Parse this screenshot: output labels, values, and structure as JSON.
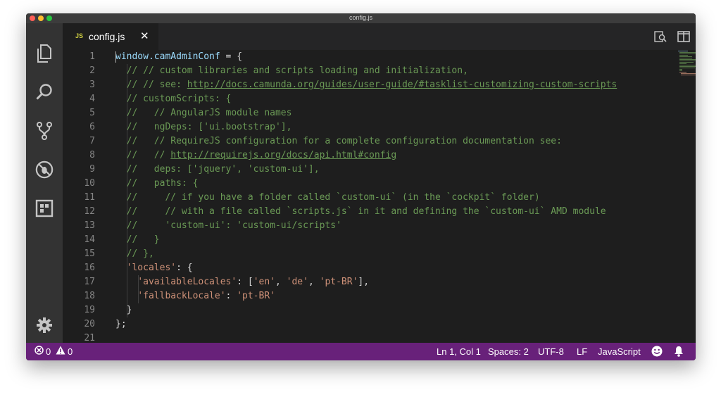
{
  "window": {
    "title": "config.js"
  },
  "tab": {
    "icon_text": "JS",
    "filename": "config.js",
    "close_glyph": "✕"
  },
  "activity_bar": [
    {
      "name": "files-icon"
    },
    {
      "name": "search-icon"
    },
    {
      "name": "source-control-icon"
    },
    {
      "name": "debug-icon"
    },
    {
      "name": "extensions-icon"
    },
    {
      "name": "gear-icon"
    }
  ],
  "toolbar_icons": [
    "open-changes-icon",
    "split-editor-icon",
    "more-actions-icon"
  ],
  "editor": {
    "lines": [
      {
        "n": "1",
        "segs": [
          {
            "c": "var",
            "t": "window.camAdminConf"
          },
          {
            "c": "",
            "t": " = {"
          }
        ]
      },
      {
        "n": "2",
        "segs": [
          {
            "c": "cmt",
            "t": "  // // custom libraries and scripts loading and initialization,"
          }
        ]
      },
      {
        "n": "3",
        "segs": [
          {
            "c": "cmt",
            "t": "  // // see: "
          },
          {
            "c": "url",
            "t": "http://docs.camunda.org/guides/user-guide/#tasklist-customizing-custom-scripts"
          }
        ]
      },
      {
        "n": "4",
        "segs": [
          {
            "c": "cmt",
            "t": "  // customScripts: {"
          }
        ]
      },
      {
        "n": "5",
        "segs": [
          {
            "c": "cmt",
            "t": "  //   // AngularJS module names"
          }
        ]
      },
      {
        "n": "6",
        "segs": [
          {
            "c": "cmt",
            "t": "  //   ngDeps: ['ui.bootstrap'],"
          }
        ]
      },
      {
        "n": "7",
        "segs": [
          {
            "c": "cmt",
            "t": "  //   // RequireJS configuration for a complete configuration documentation see:"
          }
        ]
      },
      {
        "n": "8",
        "segs": [
          {
            "c": "cmt",
            "t": "  //   // "
          },
          {
            "c": "url",
            "t": "http://requirejs.org/docs/api.html#config"
          }
        ]
      },
      {
        "n": "9",
        "segs": [
          {
            "c": "cmt",
            "t": "  //   deps: ['jquery', 'custom-ui'],"
          }
        ]
      },
      {
        "n": "10",
        "segs": [
          {
            "c": "cmt",
            "t": "  //   paths: {"
          }
        ]
      },
      {
        "n": "11",
        "segs": [
          {
            "c": "cmt",
            "t": "  //     // if you have a folder called `custom-ui` (in the `cockpit` folder)"
          }
        ]
      },
      {
        "n": "12",
        "segs": [
          {
            "c": "cmt",
            "t": "  //     // with a file called `scripts.js` in it and defining the `custom-ui` AMD module"
          }
        ]
      },
      {
        "n": "13",
        "segs": [
          {
            "c": "cmt",
            "t": "  //     'custom-ui': 'custom-ui/scripts'"
          }
        ]
      },
      {
        "n": "14",
        "segs": [
          {
            "c": "cmt",
            "t": "  //   }"
          }
        ]
      },
      {
        "n": "15",
        "segs": [
          {
            "c": "cmt",
            "t": "  // },"
          }
        ]
      },
      {
        "n": "16",
        "segs": [
          {
            "c": "",
            "t": "  "
          },
          {
            "c": "str",
            "t": "'locales'"
          },
          {
            "c": "",
            "t": ": {"
          }
        ]
      },
      {
        "n": "17",
        "segs": [
          {
            "c": "",
            "t": "    "
          },
          {
            "c": "str",
            "t": "'availableLocales'"
          },
          {
            "c": "",
            "t": ": ["
          },
          {
            "c": "str",
            "t": "'en'"
          },
          {
            "c": "",
            "t": ", "
          },
          {
            "c": "str",
            "t": "'de'"
          },
          {
            "c": "",
            "t": ", "
          },
          {
            "c": "str",
            "t": "'pt-BR'"
          },
          {
            "c": "",
            "t": "],"
          }
        ]
      },
      {
        "n": "18",
        "segs": [
          {
            "c": "",
            "t": "    "
          },
          {
            "c": "str",
            "t": "'fallbackLocale'"
          },
          {
            "c": "",
            "t": ": "
          },
          {
            "c": "str",
            "t": "'pt-BR'"
          }
        ]
      },
      {
        "n": "19",
        "segs": [
          {
            "c": "",
            "t": "  }"
          }
        ]
      },
      {
        "n": "20",
        "segs": [
          {
            "c": "",
            "t": "};"
          }
        ]
      },
      {
        "n": "21",
        "segs": []
      }
    ]
  },
  "status": {
    "errors": "0",
    "warnings": "0",
    "position": "Ln 1, Col 1",
    "spaces": "Spaces: 2",
    "encoding": "UTF-8",
    "eol": "LF",
    "language": "JavaScript"
  },
  "colors": {
    "statusbar": "#68217a",
    "comment": "#6a9955",
    "string": "#ce9178",
    "variable": "#9cdcfe"
  }
}
